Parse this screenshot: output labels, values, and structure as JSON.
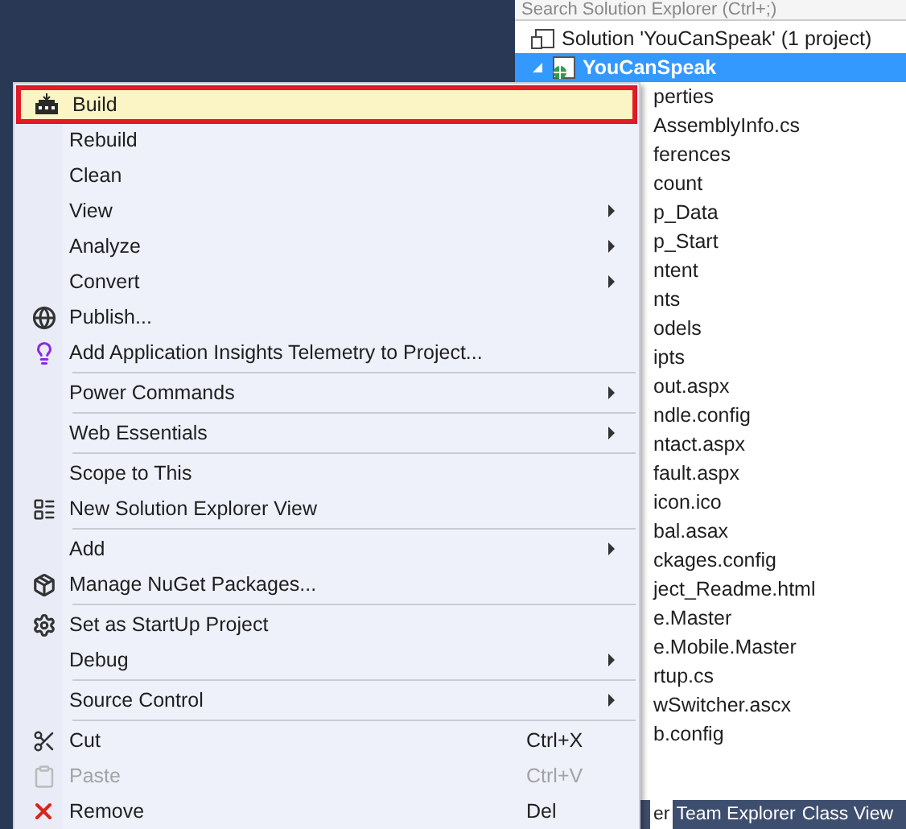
{
  "explorer": {
    "search": {
      "placeholder": "Search Solution Explorer (Ctrl+;)"
    },
    "solution": {
      "label": "Solution 'YouCanSpeak' (1 project)",
      "selected": false
    },
    "project": {
      "label": "YouCanSpeak",
      "selected": true,
      "expanded": true
    },
    "items": [
      "perties",
      "AssemblyInfo.cs",
      "ferences",
      "count",
      "p_Data",
      "p_Start",
      "ntent",
      "nts",
      "odels",
      "ipts",
      "out.aspx",
      "ndle.config",
      "ntact.aspx",
      "fault.aspx",
      "icon.ico",
      "bal.asax",
      "ckages.config",
      "ject_Readme.html",
      "e.Master",
      "e.Mobile.Master",
      "rtup.cs",
      "wSwitcher.ascx",
      "b.config"
    ]
  },
  "tabs": [
    {
      "label": "er",
      "selected": true
    },
    {
      "label": "Team Explorer",
      "selected": false
    },
    {
      "label": "Class View",
      "selected": false
    }
  ],
  "menu": [
    {
      "kind": "item",
      "label": "Build",
      "selected": true,
      "disabled": false,
      "submenu": false
    },
    {
      "kind": "item",
      "label": "Rebuild",
      "selected": false,
      "disabled": false,
      "submenu": false
    },
    {
      "kind": "item",
      "label": "Clean",
      "selected": false,
      "disabled": false,
      "submenu": false
    },
    {
      "kind": "item",
      "label": "View",
      "selected": false,
      "disabled": false,
      "submenu": true
    },
    {
      "kind": "item",
      "label": "Analyze",
      "selected": false,
      "disabled": false,
      "submenu": true
    },
    {
      "kind": "item",
      "label": "Convert",
      "selected": false,
      "disabled": false,
      "submenu": true
    },
    {
      "kind": "item",
      "label": "Publish...",
      "selected": false,
      "disabled": false,
      "submenu": false
    },
    {
      "kind": "item",
      "label": "Add Application Insights Telemetry to Project...",
      "selected": false,
      "disabled": false,
      "submenu": false
    },
    {
      "kind": "separator"
    },
    {
      "kind": "item",
      "label": "Power Commands",
      "selected": false,
      "disabled": false,
      "submenu": true
    },
    {
      "kind": "separator"
    },
    {
      "kind": "item",
      "label": "Web Essentials",
      "selected": false,
      "disabled": false,
      "submenu": true
    },
    {
      "kind": "separator"
    },
    {
      "kind": "item",
      "label": "Scope to This",
      "selected": false,
      "disabled": false,
      "submenu": false
    },
    {
      "kind": "item",
      "label": "New Solution Explorer View",
      "selected": false,
      "disabled": false,
      "submenu": false
    },
    {
      "kind": "separator"
    },
    {
      "kind": "item",
      "label": "Add",
      "selected": false,
      "disabled": false,
      "submenu": true
    },
    {
      "kind": "item",
      "label": "Manage NuGet Packages...",
      "selected": false,
      "disabled": false,
      "submenu": false
    },
    {
      "kind": "separator"
    },
    {
      "kind": "item",
      "label": "Set as StartUp Project",
      "selected": false,
      "disabled": false,
      "submenu": false
    },
    {
      "kind": "item",
      "label": "Debug",
      "selected": false,
      "disabled": false,
      "submenu": true
    },
    {
      "kind": "separator"
    },
    {
      "kind": "item",
      "label": "Source Control",
      "selected": false,
      "disabled": false,
      "submenu": true
    },
    {
      "kind": "separator"
    },
    {
      "kind": "item",
      "label": "Cut",
      "shortcut": "Ctrl+X",
      "selected": false,
      "disabled": false,
      "submenu": false
    },
    {
      "kind": "item",
      "label": "Paste",
      "shortcut": "Ctrl+V",
      "selected": false,
      "disabled": true,
      "submenu": false
    },
    {
      "kind": "item",
      "label": "Remove",
      "shortcut": "Del",
      "selected": false,
      "disabled": false,
      "submenu": false
    }
  ]
}
